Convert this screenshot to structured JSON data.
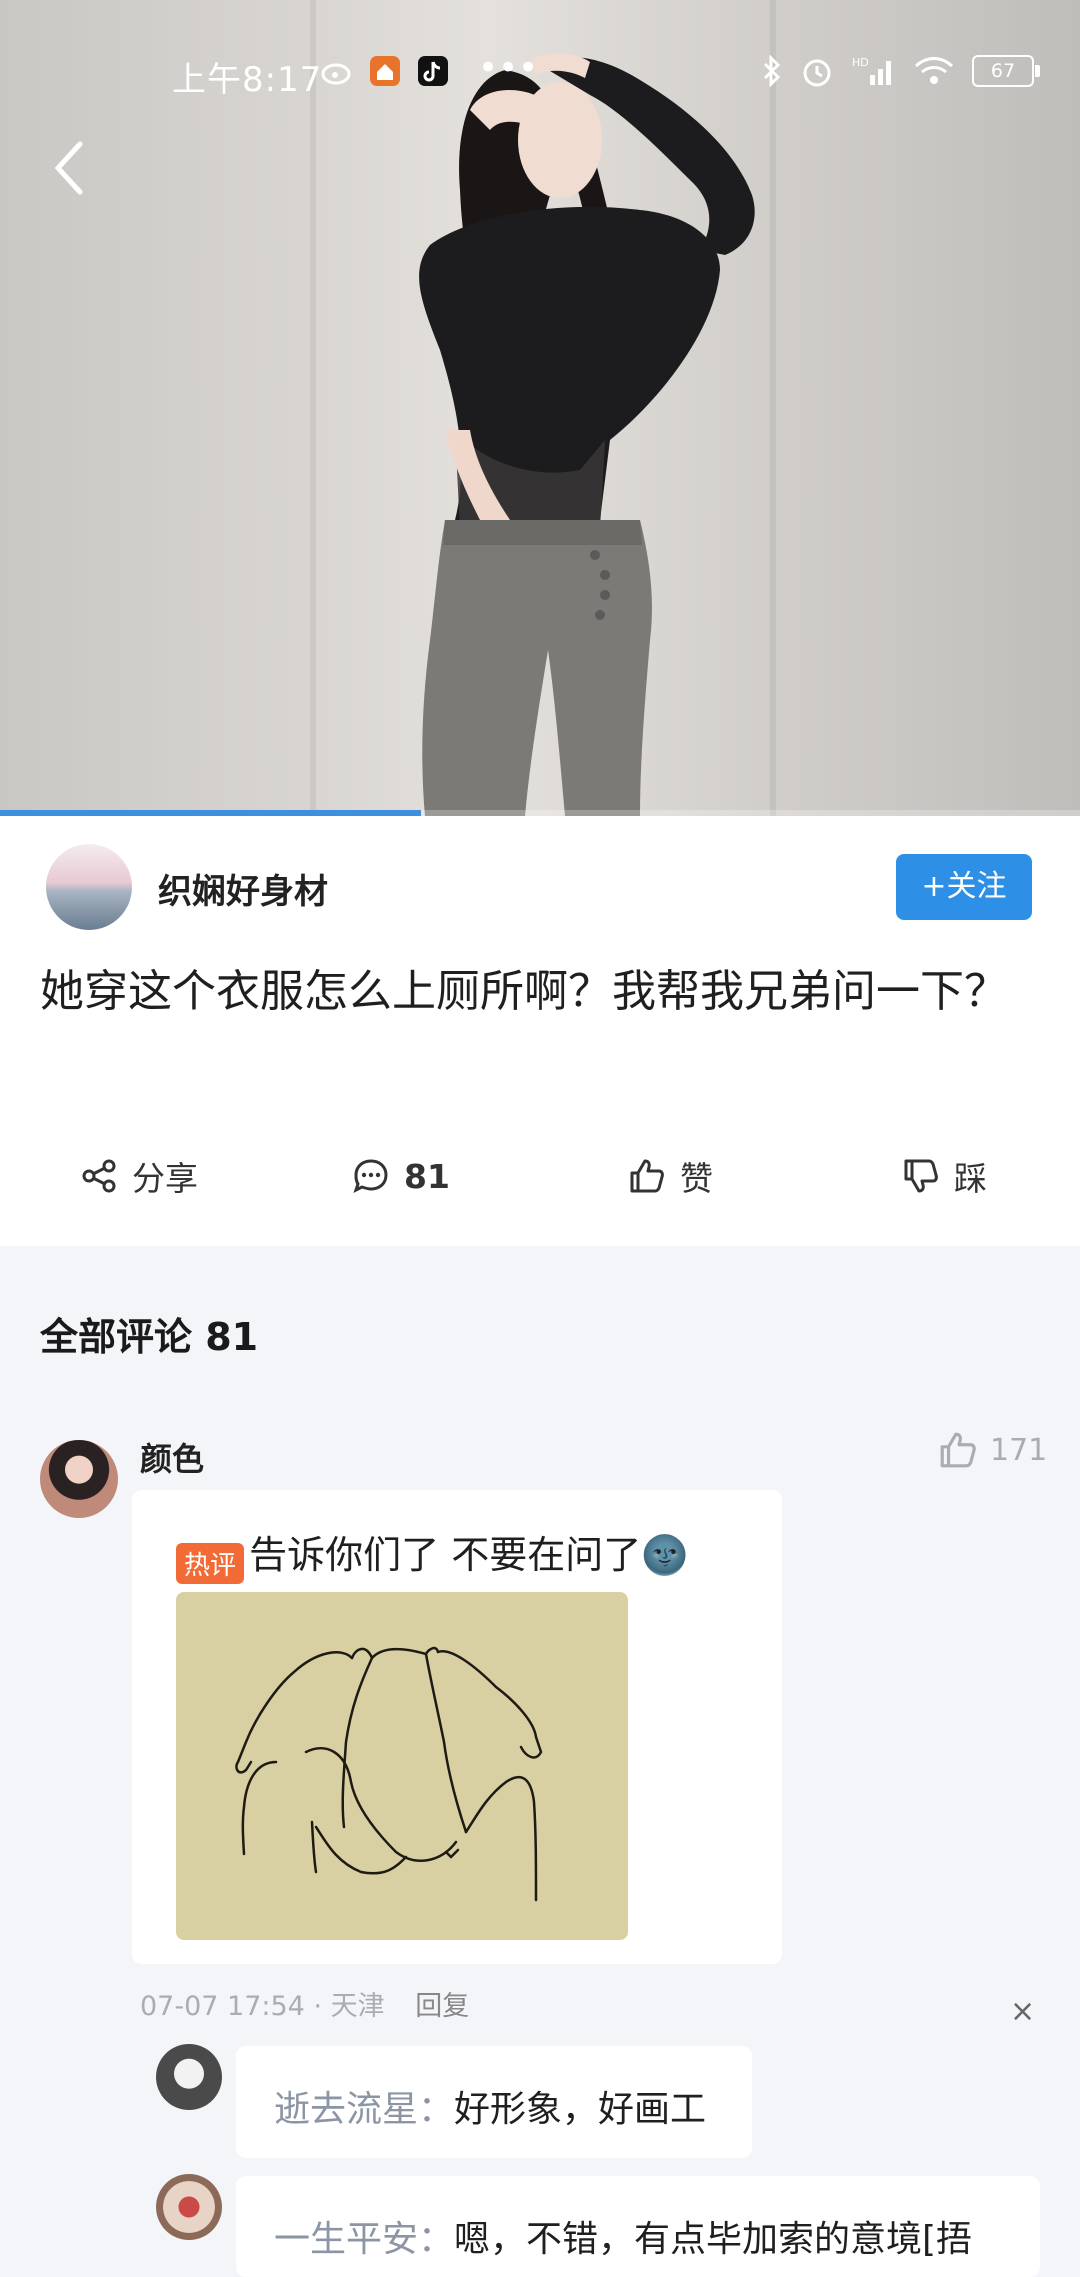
{
  "status_bar": {
    "time": "上午8:17",
    "battery": "67",
    "network": "HD",
    "app_icons": [
      "weibo-icon",
      "home-icon",
      "tiktok-icon"
    ],
    "right_icons": [
      "bluetooth-icon",
      "alarm-icon",
      "signal-icon",
      "wifi-icon",
      "battery-icon"
    ]
  },
  "video": {
    "progress_fraction": 0.39
  },
  "post": {
    "author": "织娴好身材",
    "follow_label": "+关注",
    "text": "她穿这个衣服怎么上厕所啊？我帮我兄弟问一下？",
    "actions": {
      "share": "分享",
      "comments": "81",
      "like": "赞",
      "dislike": "踩"
    }
  },
  "comments": {
    "title": "全部评论 81",
    "items": [
      {
        "name": "颜色",
        "likes": "171",
        "tag": "热评",
        "text": "告诉你们了 不要在问了🌚",
        "date": "07-07 17:54",
        "sep": "·",
        "location": "天津",
        "reply_label": "回复",
        "close": "×",
        "replies": [
          {
            "name": "逝去流星：",
            "text": "好形象，好画工"
          },
          {
            "name": "一生平安：",
            "text": "嗯，不错，有点毕加索的意境[捂"
          }
        ]
      }
    ]
  },
  "colors": {
    "accent": "#2e8fe6",
    "hot_tag": "#f26b36",
    "background": "#f3f5f8"
  }
}
